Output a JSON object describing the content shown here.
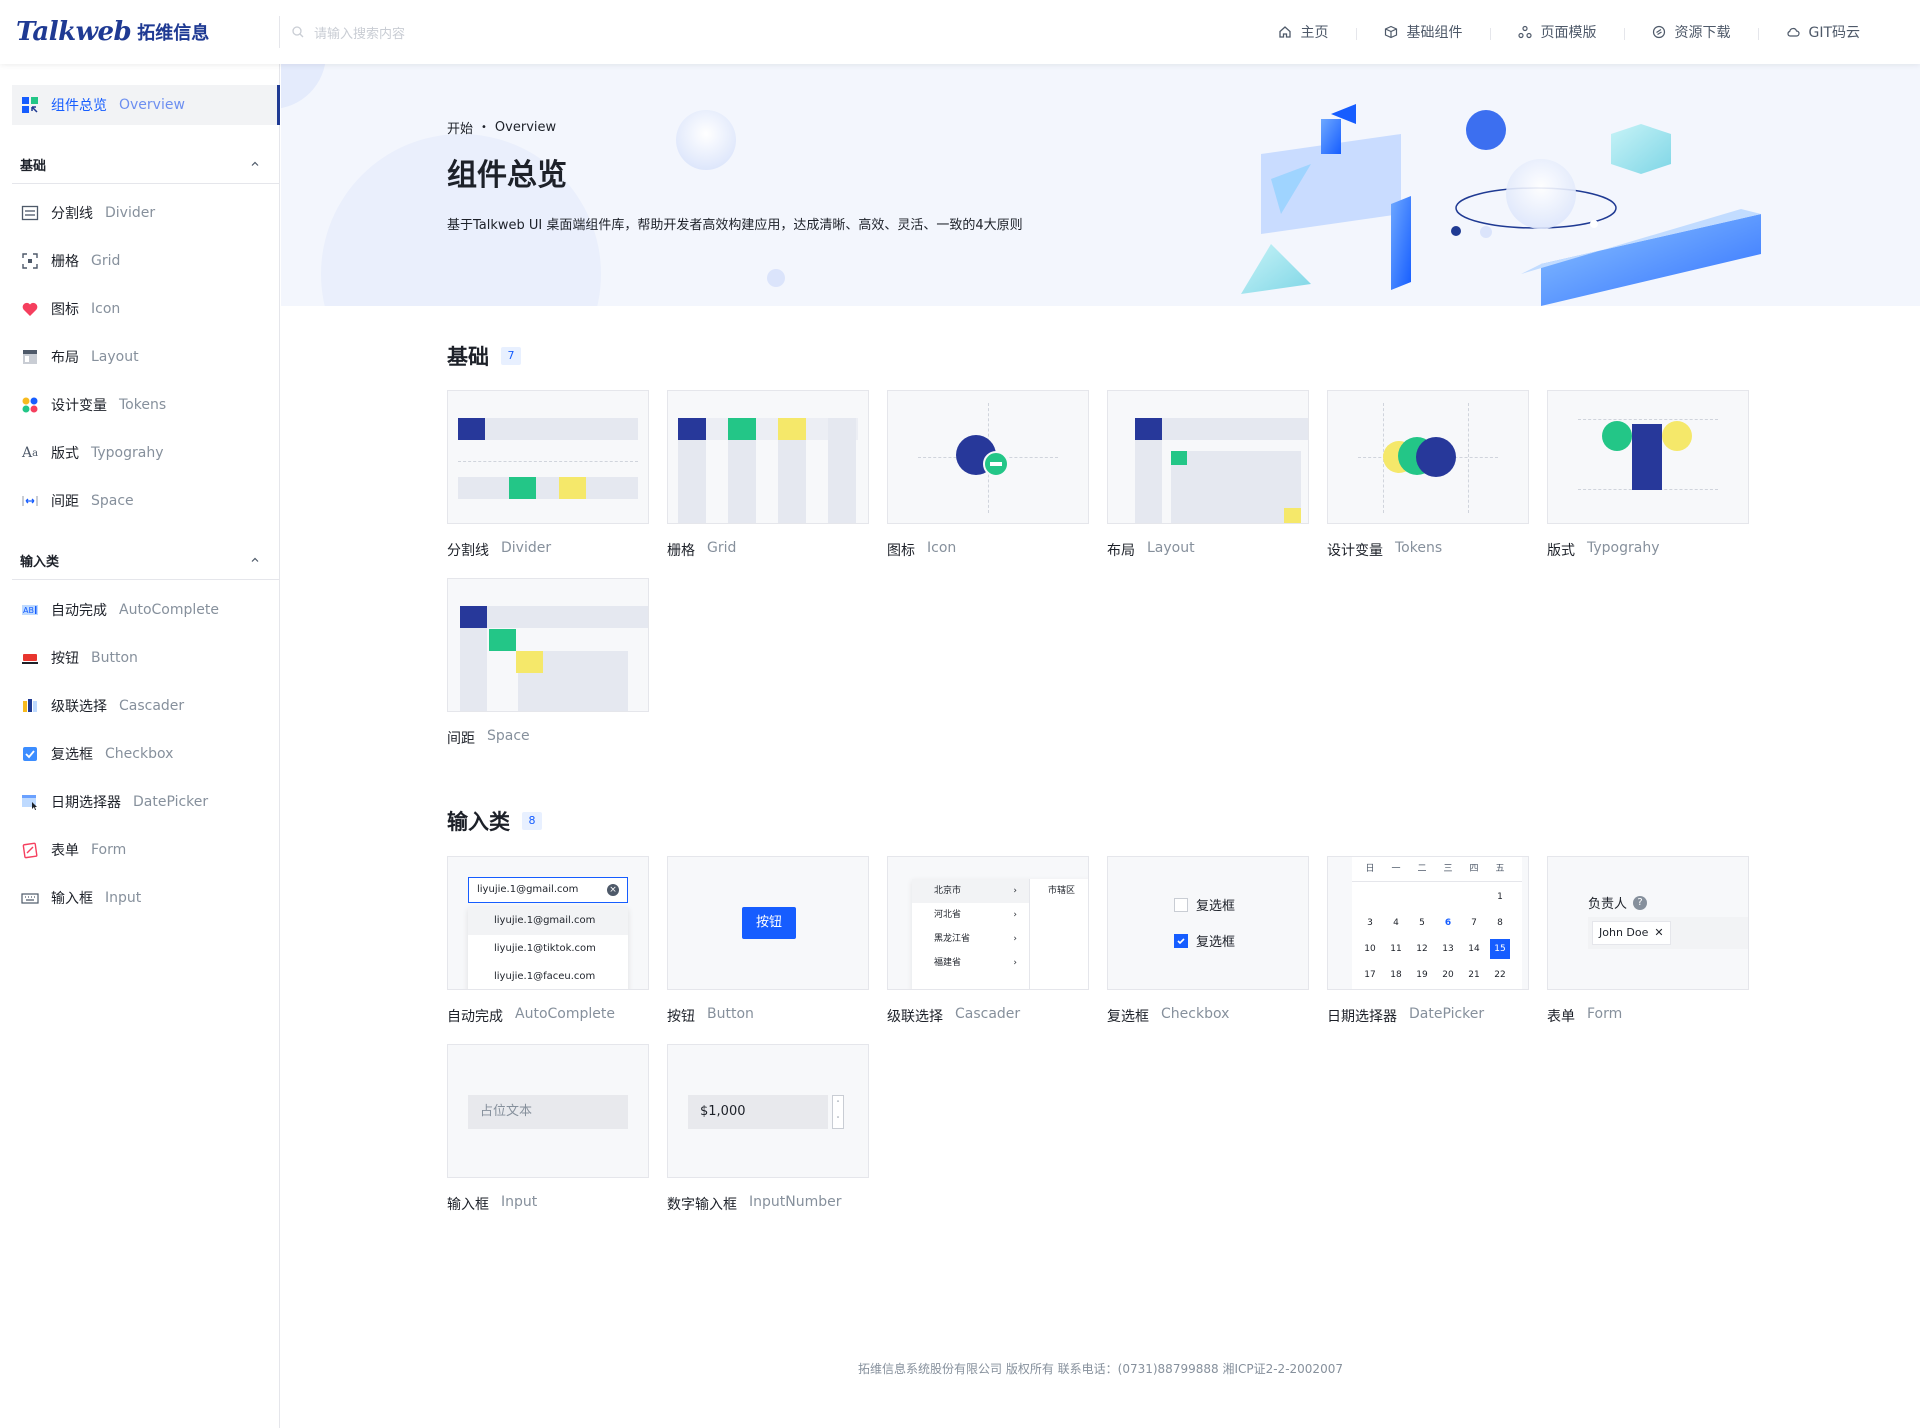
{
  "header": {
    "brand_latin": "Talkweb",
    "brand_cn": "拓维信息",
    "search_placeholder": "请输入搜索内容",
    "nav": [
      {
        "label": "主页",
        "icon": "home-icon"
      },
      {
        "label": "基础组件",
        "icon": "cube-icon"
      },
      {
        "label": "页面模版",
        "icon": "template-icon"
      },
      {
        "label": "资源下载",
        "icon": "download-icon"
      },
      {
        "label": "GIT码云",
        "icon": "cloud-icon"
      }
    ]
  },
  "sidebar": {
    "active": {
      "cn": "组件总览",
      "en": "Overview"
    },
    "groups": [
      {
        "title": "基础",
        "items": [
          {
            "cn": "分割线",
            "en": "Divider"
          },
          {
            "cn": "栅格",
            "en": "Grid"
          },
          {
            "cn": "图标",
            "en": "Icon"
          },
          {
            "cn": "布局",
            "en": "Layout"
          },
          {
            "cn": "设计变量",
            "en": "Tokens"
          },
          {
            "cn": "版式",
            "en": "Typograhy"
          },
          {
            "cn": "间距",
            "en": "Space"
          }
        ]
      },
      {
        "title": "输入类",
        "items": [
          {
            "cn": "自动完成",
            "en": "AutoComplete"
          },
          {
            "cn": "按钮",
            "en": "Button"
          },
          {
            "cn": "级联选择",
            "en": "Cascader"
          },
          {
            "cn": "复选框",
            "en": "Checkbox"
          },
          {
            "cn": "日期选择器",
            "en": "DatePicker"
          },
          {
            "cn": "表单",
            "en": "Form"
          },
          {
            "cn": "输入框",
            "en": "Input"
          }
        ]
      }
    ]
  },
  "hero": {
    "crumb_start": "开始",
    "crumb_current": "Overview",
    "title": "组件总览",
    "description": "基于Talkweb UI 桌面端组件库，帮助开发者高效构建应用，达成清晰、高效、灵活、一致的4大原则"
  },
  "sections": [
    {
      "title": "基础",
      "count": "7",
      "cards": [
        {
          "cn": "分割线",
          "en": "Divider"
        },
        {
          "cn": "栅格",
          "en": "Grid"
        },
        {
          "cn": "图标",
          "en": "Icon"
        },
        {
          "cn": "布局",
          "en": "Layout"
        },
        {
          "cn": "设计变量",
          "en": "Tokens"
        },
        {
          "cn": "版式",
          "en": "Typograhy"
        },
        {
          "cn": "间距",
          "en": "Space"
        }
      ]
    },
    {
      "title": "输入类",
      "count": "8",
      "cards": [
        {
          "cn": "自动完成",
          "en": "AutoComplete"
        },
        {
          "cn": "按钮",
          "en": "Button"
        },
        {
          "cn": "级联选择",
          "en": "Cascader"
        },
        {
          "cn": "复选框",
          "en": "Checkbox"
        },
        {
          "cn": "日期选择器",
          "en": "DatePicker"
        },
        {
          "cn": "表单",
          "en": "Form"
        },
        {
          "cn": "输入框",
          "en": "Input"
        },
        {
          "cn": "数字输入框",
          "en": "InputNumber"
        }
      ]
    }
  ],
  "previews": {
    "autocomplete_value": "liyujie.1@gmail.com",
    "autocomplete_options": [
      "liyujie.1@gmail.com",
      "liyujie.1@tiktok.com",
      "liyujie.1@faceu.com"
    ],
    "button_label": "按钮",
    "cascader_left": [
      "北京市",
      "河北省",
      "黑龙江省",
      "福建省"
    ],
    "cascader_right": "市辖区",
    "checkbox_label": "复选框",
    "datepicker_week": [
      "日",
      "一",
      "二",
      "三",
      "四",
      "五"
    ],
    "datepicker_rows": [
      [
        "",
        "",
        "",
        "",
        "",
        "1"
      ],
      [
        "3",
        "4",
        "5",
        "6",
        "7",
        "8"
      ],
      [
        "10",
        "11",
        "12",
        "13",
        "14",
        "15"
      ],
      [
        "17",
        "18",
        "19",
        "20",
        "21",
        "22"
      ]
    ],
    "datepicker_selected": "15",
    "datepicker_highlight": "6",
    "form_label": "负责人",
    "form_tag": "John Doe",
    "input_placeholder": "占位文本",
    "inputnumber_value": "$1,000"
  },
  "colors": {
    "primary": "#165dff",
    "brand_navy": "#1f3a93",
    "accent_green": "#23c687",
    "accent_yellow": "#f5e86a"
  },
  "footer": "拓维信息系统股份有限公司 版权所有 联系电话：(0731)88799888 湘ICP证2-2-2002007"
}
